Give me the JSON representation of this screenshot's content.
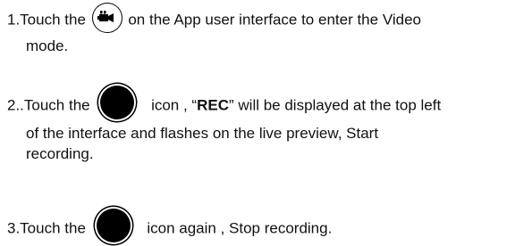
{
  "steps": [
    {
      "before": "1.Touch the ",
      "after": " on the App user interface to enter the Video",
      "line2": "mode.",
      "icon": "video-camera-icon"
    },
    {
      "before": "2..Touch the ",
      "after_a": " icon , “",
      "bold": "REC",
      "after_b": "” will be displayed at the top left",
      "line2": "of the interface and flashes on the live preview, Start",
      "line3": "recording.",
      "icon": "record-button-icon"
    },
    {
      "before": "3.Touch the ",
      "after": " icon again , Stop recording.",
      "icon": "record-button-icon"
    }
  ]
}
